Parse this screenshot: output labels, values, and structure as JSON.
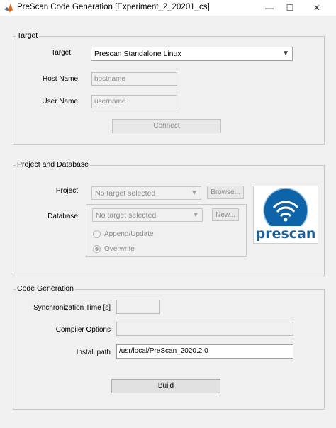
{
  "window": {
    "title": "PreScan Code Generation [Experiment_2_20201_cs]",
    "controls": {
      "minimize": "—",
      "maximize": "☐",
      "close": "✕"
    }
  },
  "target": {
    "group_title": "Target",
    "target_label": "Target",
    "target_value": "Prescan Standalone Linux",
    "host_label": "Host Name",
    "host_placeholder": "hostname",
    "user_label": "User Name",
    "user_placeholder": "username",
    "connect_label": "Connect"
  },
  "project_db": {
    "group_title": "Project and Database",
    "project_label": "Project",
    "project_value": "No target selected",
    "browse_label": "Browse...",
    "database_label": "Database",
    "database_value": "No target selected",
    "new_label": "New...",
    "append_label": "Append/Update",
    "overwrite_label": "Overwrite",
    "overwrite_selected": true
  },
  "logo": {
    "text": "prescan",
    "color": "#1a5f99"
  },
  "codegen": {
    "group_title": "Code Generation",
    "sync_label": "Synchronization Time [s]",
    "sync_value": "",
    "compiler_label": "Compiler Options",
    "compiler_value": "",
    "install_label": "Install path",
    "install_value": "/usr/local/PreScan_2020.2.0",
    "build_label": "Build"
  },
  "icons": {
    "app": "matlab-icon",
    "dropdown": "chevron-down-icon",
    "radio": "radio-button-icon"
  }
}
